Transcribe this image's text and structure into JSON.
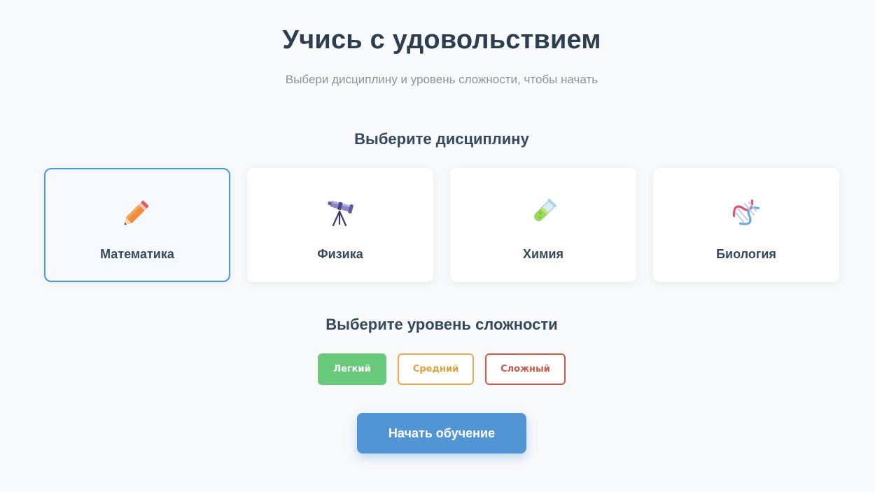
{
  "header": {
    "title": "Учись с удовольствием",
    "subtitle": "Выбери дисциплину и уровень сложности, чтобы начать"
  },
  "disciplines": {
    "heading": "Выберите дисциплину",
    "selected": "Математика",
    "items": [
      {
        "label": "Математика",
        "icon": "pencil-icon"
      },
      {
        "label": "Физика",
        "icon": "telescope-icon"
      },
      {
        "label": "Химия",
        "icon": "test-tube-icon"
      },
      {
        "label": "Биология",
        "icon": "dna-icon"
      }
    ]
  },
  "levels": {
    "heading": "Выберите уровень сложности",
    "selected": "Легкий",
    "items": [
      {
        "label": "Легкий",
        "color": "#68c97a"
      },
      {
        "label": "Средний",
        "color": "#e6aa55"
      },
      {
        "label": "Сложный",
        "color": "#d2584a"
      }
    ]
  },
  "actions": {
    "start_label": "Начать обучение",
    "start_color": "#5195d5"
  },
  "colors": {
    "selected_border": "#4a9bd2",
    "background": "#f8f9fb"
  }
}
